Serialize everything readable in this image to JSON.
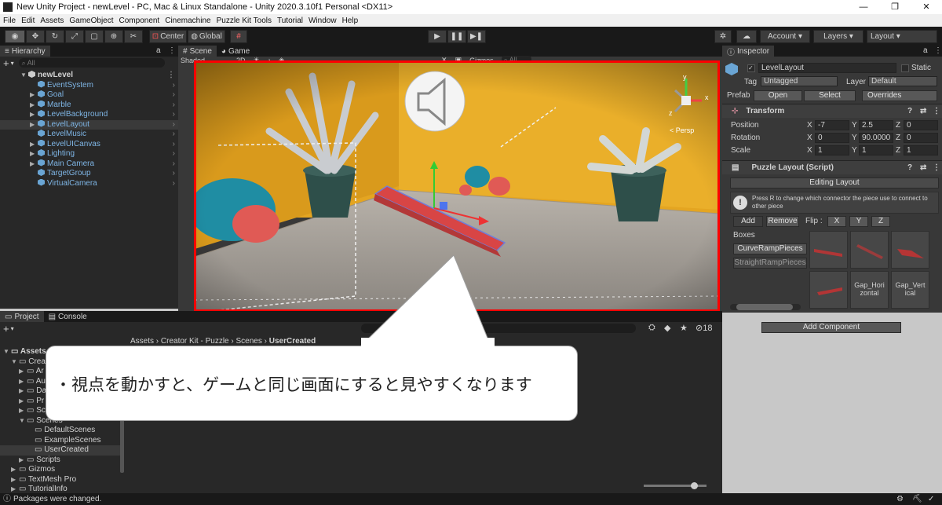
{
  "window": {
    "title": "New Unity Project - newLevel - PC, Mac & Linux Standalone - Unity 2020.3.10f1 Personal <DX11>",
    "min": "—",
    "max": "❐",
    "close": "✕"
  },
  "menu": [
    "File",
    "Edit",
    "Assets",
    "GameObject",
    "Component",
    "Cinemachine",
    "Puzzle Kit Tools",
    "Tutorial",
    "Window",
    "Help"
  ],
  "toolbar": {
    "center": "Center",
    "global": "Global",
    "account": "Account ▾",
    "layers": "Layers ▾",
    "layout": "Layout ▾"
  },
  "hierarchy": {
    "tab": "Hierarchy",
    "search_placeholder": "All",
    "scene": "newLevel",
    "items": [
      "EventSystem",
      "Goal",
      "Marble",
      "LevelBackground",
      "LevelLayout",
      "LevelMusic",
      "LevelUICanvas",
      "Lighting",
      "Main Camera",
      "TargetGroup",
      "VirtualCamera"
    ],
    "selected_index": 4
  },
  "scene": {
    "tab_scene": "Scene",
    "tab_game": "Game",
    "shading": "Shaded",
    "mode2d": "2D",
    "gizmos": "Gizmos",
    "search_placeholder": "All",
    "persp": "< Persp",
    "axis_y": "y",
    "axis_x": "x",
    "axis_z": "z"
  },
  "inspector": {
    "tab": "Inspector",
    "object_name": "LevelLayout",
    "static": "Static",
    "tag_label": "Tag",
    "tag": "Untagged",
    "layer_label": "Layer",
    "layer": "Default",
    "prefab_label": "Prefab",
    "open": "Open",
    "select": "Select",
    "overrides": "Overrides",
    "transform": {
      "title": "Transform",
      "position_label": "Position",
      "rotation_label": "Rotation",
      "scale_label": "Scale",
      "pos": [
        "-7",
        "2.5",
        "0"
      ],
      "rot": [
        "0",
        "90.0000",
        "0"
      ],
      "scale": [
        "1",
        "1",
        "1"
      ]
    },
    "script": {
      "title": "Puzzle Layout (Script)",
      "editing": "Editing Layout",
      "help": "Press R to change which connector the piece use to connect to other piece",
      "add": "Add",
      "remove": "Remove",
      "flip_label": "Flip :",
      "flip": [
        "X",
        "Y",
        "Z"
      ],
      "boxes_label": "Boxes",
      "boxes": [
        "CurveRampPieces",
        "StraightRampPieces"
      ],
      "thumb_gap_h": "Gap_Hori zontal",
      "thumb_gap_v": "Gap_Vert ical"
    },
    "add_component": "Add Component"
  },
  "project": {
    "tab_project": "Project",
    "tab_console": "Console",
    "count": "18",
    "breadcrumb": [
      "Assets",
      "Creator Kit - Puzzle",
      "Scenes",
      "UserCreated"
    ],
    "tree": [
      {
        "label": "Assets",
        "indent": 0
      },
      {
        "label": "Creat",
        "indent": 1
      },
      {
        "label": "Ar",
        "indent": 2
      },
      {
        "label": "Au",
        "indent": 2
      },
      {
        "label": "Da",
        "indent": 2
      },
      {
        "label": "Pr",
        "indent": 2
      },
      {
        "label": "Sc",
        "indent": 2
      },
      {
        "label": "Scenes",
        "indent": 2
      },
      {
        "label": "DefaultScenes",
        "indent": 3
      },
      {
        "label": "ExampleScenes",
        "indent": 3
      },
      {
        "label": "UserCreated",
        "indent": 3
      },
      {
        "label": "Scripts",
        "indent": 2
      },
      {
        "label": "Gizmos",
        "indent": 1
      },
      {
        "label": "TextMesh Pro",
        "indent": 1
      },
      {
        "label": "TutorialInfo",
        "indent": 1
      }
    ]
  },
  "status": "Packages were changed.",
  "callout": "・視点を動かすと、ゲームと同じ画面にすると見やすくなります",
  "colors": {
    "highlight": "#ff0000",
    "wall": "#e4a521",
    "hier_text": "#7fb6e6"
  }
}
